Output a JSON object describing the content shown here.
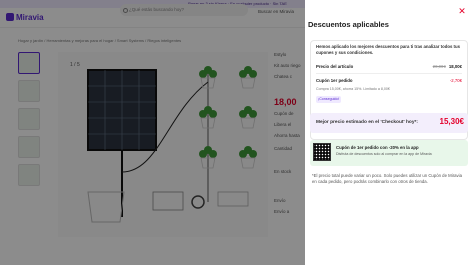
{
  "promo_bar": {
    "text": "Pagar en 3 sin Klarna · En cualquier producto · Sin TAE"
  },
  "header": {
    "brand": "Miravia",
    "search_placeholder": "¿Qué estás buscando hoy?",
    "links": [
      "Buscar en Miravia",
      "Buscar en Miravia"
    ]
  },
  "breadcrumb": "Hogar y jardín  /  Herramientas y mejoras para el hogar  /  Smart Systems  /  Riegos inteligentes",
  "product": {
    "image_counter": "1 / 5",
    "side_texts": [
      "Estylo",
      "Kit auto riego",
      "Chatea c",
      "Cupón de",
      "Libera el ",
      "Ahorra hasta",
      "Cantidad",
      "En stock",
      "Envío",
      "Envío a"
    ],
    "price": "18,00"
  },
  "panel": {
    "title": "Descuentos aplicables",
    "intro": "Hemos aplicado los mejores descuentos para ti tras analizar todos tus cupones y sus condiciones.",
    "rows": {
      "article_price_label": "Precio del artículo",
      "article_old_price": "20,00€",
      "article_price": "18,00€",
      "coupon_label": "Cupón 1er pedido",
      "coupon_value": "-2,70€",
      "coupon_note": "Compra 15,00€, ahorra 15%. Limitado a 8,00€",
      "tag": "¡Conseguido!"
    },
    "best": {
      "label": "Mejor precio estimado en el 'Checkout' hoy*:",
      "value": "15,30€"
    },
    "app": {
      "title": "Cupón de 1er pedido con -20% en la app",
      "subtitle": "Disfruta de descuentos solo al comprar en la app de Miravia"
    },
    "footnote": "*El precio total puede variar un poco. Solo puedes utilizar un Cupón de Miravia en cada pedido, pero podrás combinarlo con otros de tienda."
  },
  "colors": {
    "brand": "#5b2bd1",
    "price_red": "#e4002b"
  }
}
